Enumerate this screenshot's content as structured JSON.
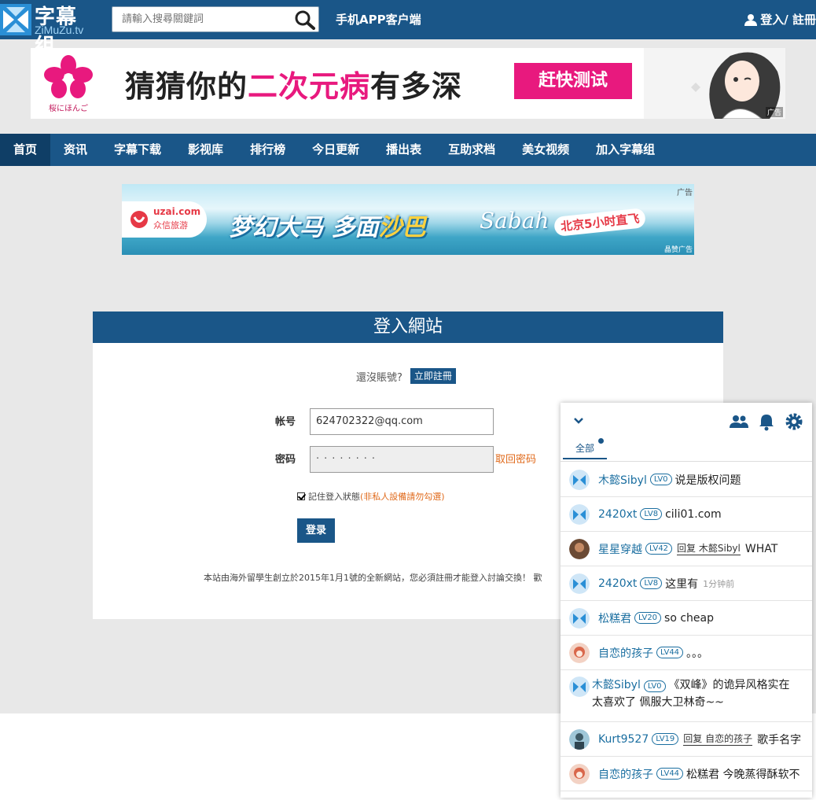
{
  "header": {
    "logo_cn": "字幕组",
    "logo_en": "ZiMuZu.tv",
    "search_placeholder": "請輸入搜尋關鍵詞",
    "app_link": "手机APP客户端",
    "login_link": "登入/ 註冊"
  },
  "banner_top": {
    "brand": "桜にほんご",
    "title_a": "猜猜你的",
    "title_b": "二次元病",
    "title_c": "有多深",
    "button": "赶快测试",
    "ad_mark": "广告"
  },
  "nav": {
    "items": [
      "首页",
      "资讯",
      "字幕下载",
      "影视库",
      "排行榜",
      "今日更新",
      "播出表",
      "互助求档",
      "美女视频",
      "加入字幕组"
    ]
  },
  "banner_mid": {
    "brand_en": "uzai.com",
    "brand_cn": "众信旅游",
    "main_a": "梦幻大马 多面",
    "main_b": "沙巴",
    "script": "Sabah",
    "tag": "北京5小时直飞",
    "ad_mark": "广告",
    "ad_mark2": "晶赞广告"
  },
  "login": {
    "title": "登入網站",
    "no_account": "還沒賬號?",
    "register_btn": "立即註冊",
    "account_label": "帐号",
    "account_value": "624702322@qq.com",
    "password_label": "密码",
    "password_value": "········",
    "forgot": "取回密码",
    "remember": "記住登入狀態",
    "remember_warn": "(非私人設備請勿勾選)",
    "submit": "登录",
    "notice": "本站由海外留學生創立於2015年1月1號的全新網站，您必須註冊才能登入討論交換！ 歡"
  },
  "chat": {
    "tab_all": "全部",
    "messages": [
      {
        "user": "木懿Sibyl",
        "lv": "LV0",
        "reply": "",
        "text": "说是版权问题",
        "time": ""
      },
      {
        "user": "2420xt",
        "lv": "LV8",
        "reply": "",
        "text": "cili01.com",
        "time": ""
      },
      {
        "user": "星星穿越",
        "lv": "LV42",
        "reply": "回复 木懿Sibyl",
        "text": "WHAT",
        "time": ""
      },
      {
        "user": "2420xt",
        "lv": "LV8",
        "reply": "",
        "text": "这里有",
        "time": "1分钟前"
      },
      {
        "user": "松糕君",
        "lv": "LV20",
        "reply": "",
        "text": "so cheap",
        "time": ""
      },
      {
        "user": "自恋的孩子",
        "lv": "LV44",
        "reply": "",
        "text": "。。。",
        "time": ""
      },
      {
        "user": "木懿Sibyl",
        "lv": "LV0",
        "reply": "",
        "text": "《双峰》的诡异风格实在太喜欢了 佩服大卫林奇~~",
        "time": ""
      },
      {
        "user": "Kurt9527",
        "lv": "LV19",
        "reply": "回复 自恋的孩子",
        "text": "歌手名字",
        "time": ""
      },
      {
        "user": "自恋的孩子",
        "lv": "LV44",
        "reply": "",
        "text": "松糕君 今晚蒸得酥软不",
        "time": ""
      }
    ]
  },
  "colors": {
    "brand_blue": "#1a5688",
    "nav_active": "#0f3e66",
    "accent_orange": "#e06a1b",
    "banner_pink": "#e8197e"
  }
}
